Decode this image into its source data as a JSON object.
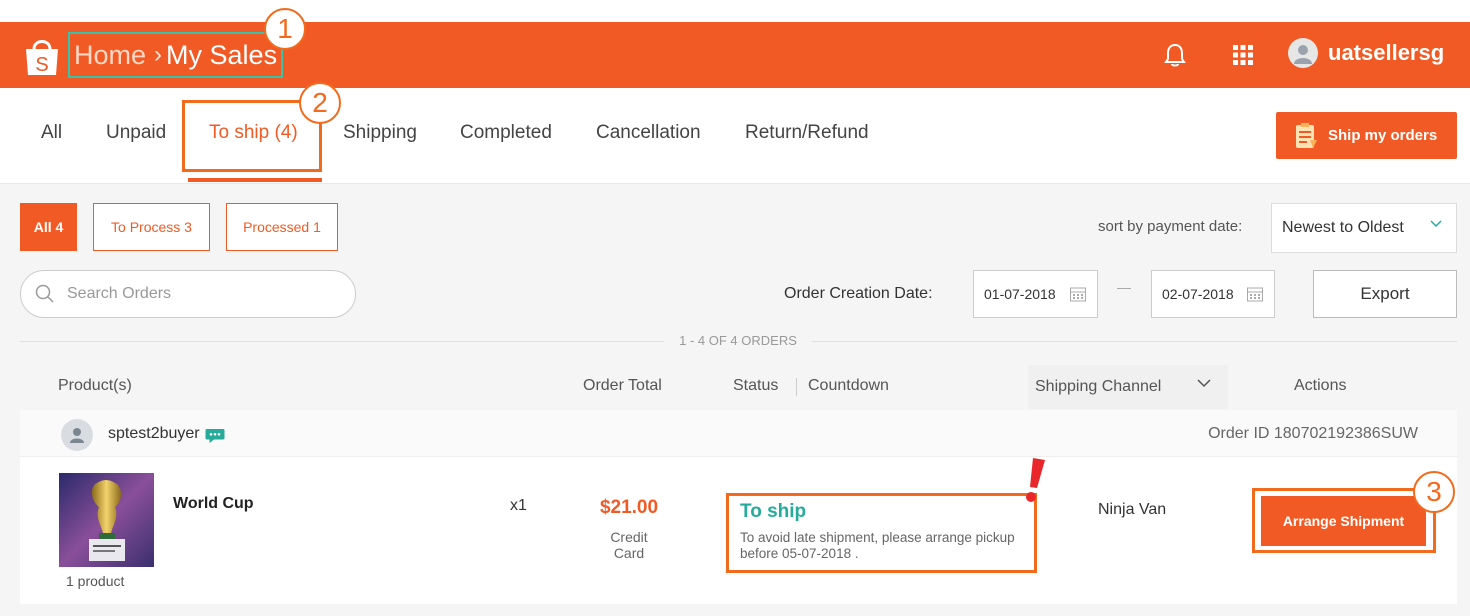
{
  "header": {
    "breadcrumb_home": "Home",
    "breadcrumb_sep": "›",
    "breadcrumb_current": "My Sales",
    "username": "uatsellersg",
    "icons": [
      "shopee-bag-icon",
      "bell-icon",
      "apps-grid-icon",
      "user-avatar-icon"
    ]
  },
  "callouts": {
    "one": "1",
    "two": "2",
    "three": "3"
  },
  "tabs": [
    {
      "label": "All"
    },
    {
      "label": "Unpaid"
    },
    {
      "label": "To ship (4)"
    },
    {
      "label": "Shipping"
    },
    {
      "label": "Completed"
    },
    {
      "label": "Cancellation"
    },
    {
      "label": "Return/Refund"
    }
  ],
  "ship_orders_button": "Ship my orders",
  "filters": {
    "all": "All 4",
    "to_process": "To Process 3",
    "processed": "Processed 1"
  },
  "sort": {
    "label": "sort by payment date:",
    "selected": "Newest to Oldest"
  },
  "search": {
    "placeholder": "Search Orders"
  },
  "date_filter": {
    "label": "Order Creation Date:",
    "from": "01-07-2018",
    "to": "02-07-2018"
  },
  "export_label": "Export",
  "order_count": "1 - 4 OF 4 ORDERS",
  "columns": {
    "products": "Product(s)",
    "total": "Order Total",
    "status": "Status",
    "countdown": "Countdown",
    "shipping_channel": "Shipping Channel",
    "actions": "Actions"
  },
  "order": {
    "buyer": "sptest2buyer",
    "order_id": "Order ID 180702192386SUW",
    "product_name": "World Cup",
    "product_count": "1 product",
    "quantity": "x1",
    "price": "$21.00",
    "payment_method": "Credit Card",
    "status": "To ship",
    "status_note_line1": "To avoid late shipment, please arrange pickup",
    "status_note_line2": "before 05-07-2018 .",
    "carrier": "Ninja Van",
    "action": "Arrange Shipment"
  },
  "colors": {
    "brand": "#f15a24",
    "annotation": "#f26b1d",
    "teal": "#26aa99",
    "highlight_box": "#3bc1a8"
  }
}
